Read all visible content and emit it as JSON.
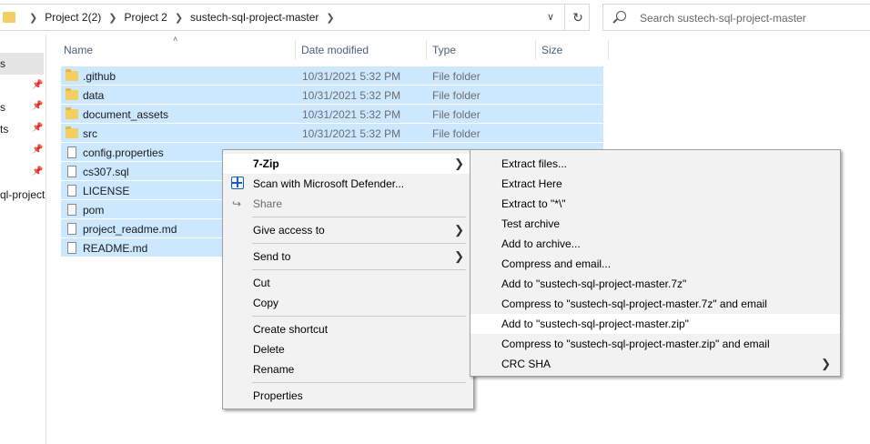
{
  "address": {
    "crumbs": [
      "Project 2(2)",
      "Project 2",
      "sustech-sql-project-master"
    ]
  },
  "search": {
    "placeholder": "Search sustech-sql-project-master"
  },
  "nav": {
    "items": [
      "s",
      "s",
      "ts",
      "ql-project"
    ]
  },
  "columns": {
    "name": "Name",
    "date": "Date modified",
    "type": "Type",
    "size": "Size"
  },
  "files": [
    {
      "name": ".github",
      "date": "10/31/2021 5:32 PM",
      "type": "File folder",
      "kind": "folder"
    },
    {
      "name": "data",
      "date": "10/31/2021 5:32 PM",
      "type": "File folder",
      "kind": "folder"
    },
    {
      "name": "document_assets",
      "date": "10/31/2021 5:32 PM",
      "type": "File folder",
      "kind": "folder"
    },
    {
      "name": "src",
      "date": "10/31/2021 5:32 PM",
      "type": "File folder",
      "kind": "folder"
    },
    {
      "name": "config.properties",
      "kind": "file"
    },
    {
      "name": "cs307.sql",
      "kind": "file"
    },
    {
      "name": "LICENSE",
      "kind": "file"
    },
    {
      "name": "pom",
      "kind": "file-img"
    },
    {
      "name": "project_readme.md",
      "kind": "file"
    },
    {
      "name": "README.md",
      "kind": "file"
    }
  ],
  "context_menu": {
    "seven_zip": "7-Zip",
    "defender": "Scan with Microsoft Defender...",
    "share": "Share",
    "give_access": "Give access to",
    "send_to": "Send to",
    "cut": "Cut",
    "copy": "Copy",
    "create_shortcut": "Create shortcut",
    "delete": "Delete",
    "rename": "Rename",
    "properties": "Properties"
  },
  "submenu": [
    "Extract files...",
    "Extract Here",
    "Extract to \"*\\\"",
    "Test archive",
    "Add to archive...",
    "Compress and email...",
    "Add to \"sustech-sql-project-master.7z\"",
    "Compress to \"sustech-sql-project-master.7z\" and email",
    "Add to \"sustech-sql-project-master.zip\"",
    "Compress to \"sustech-sql-project-master.zip\" and email",
    "CRC SHA"
  ]
}
